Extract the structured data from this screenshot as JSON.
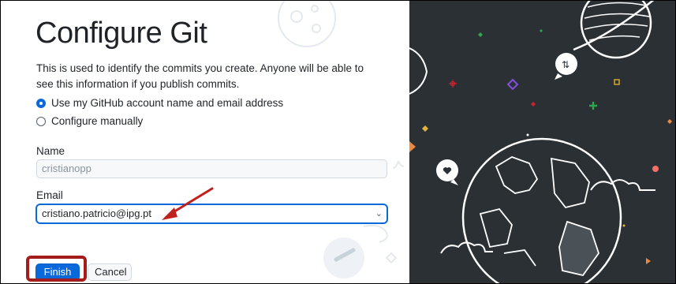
{
  "title": "Configure Git",
  "description": "This is used to identify the commits you create. Anyone will be able to see this information if you publish commits.",
  "options": {
    "use_account": "Use my GitHub account name and email address",
    "manual": "Configure manually",
    "selected": "use_account"
  },
  "name": {
    "label": "Name",
    "value": "cristianopp"
  },
  "email": {
    "label": "Email",
    "value": "cristiano.patricio@ipg.pt"
  },
  "buttons": {
    "finish": "Finish",
    "cancel": "Cancel"
  },
  "colors": {
    "accent": "#0969da",
    "annotation_red": "#a51c1c",
    "illustration_bg": "#2b3034"
  },
  "annotations": {
    "arrow": "red arrow pointing to email field",
    "box": "red box around Finish button"
  }
}
